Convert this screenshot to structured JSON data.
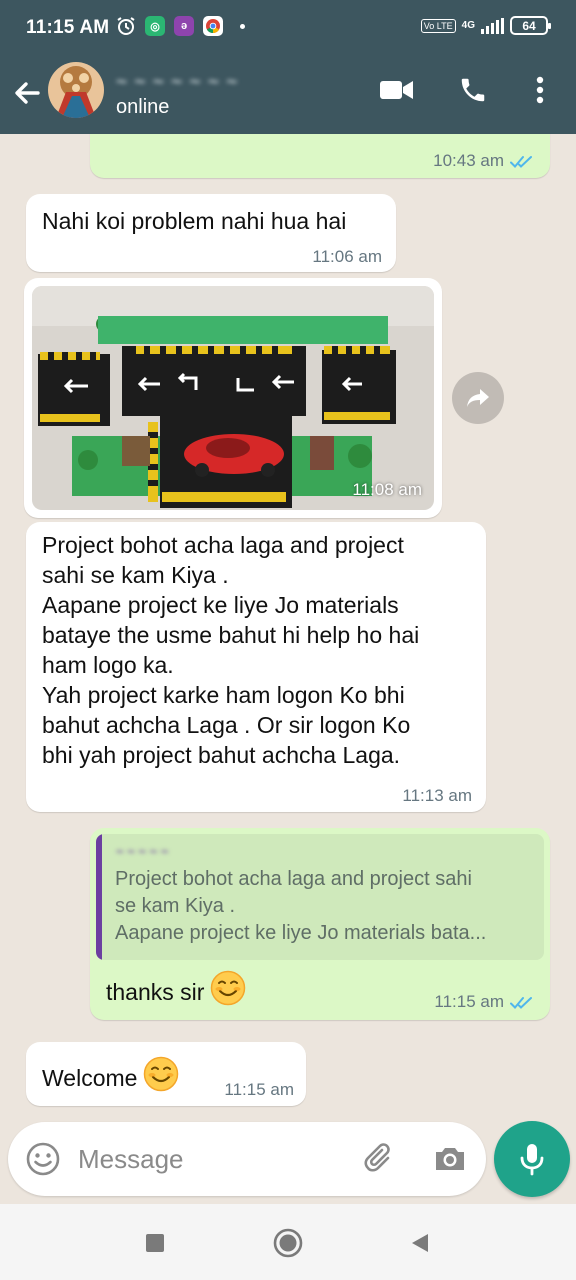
{
  "status_bar": {
    "time": "11:15 AM",
    "battery": "64",
    "network": "4G",
    "volte": "Vo LTE"
  },
  "header": {
    "contact_name": "~ ~ ~ ~ ~ ~ ~",
    "presence": "online"
  },
  "messages": [
    {
      "direction": "out",
      "partial": true,
      "time": "10:43 am",
      "status": "read"
    },
    {
      "direction": "in",
      "text": "Nahi koi problem nahi hua hai",
      "time": "11:06 am"
    },
    {
      "direction": "in",
      "type": "image",
      "time": "11:08 am"
    },
    {
      "direction": "in",
      "lines": [
        "Project bohot acha laga and project",
        "sahi se kam Kiya .",
        "Aapane project ke liye Jo materials",
        "bataye the usme bahut hi help ho hai",
        "ham logo ka.",
        "Yah project karke ham logon Ko bhi",
        "bahut achcha Laga . Or sir logon Ko",
        "bhi yah project bahut achcha Laga."
      ],
      "time": "11:13 am"
    },
    {
      "direction": "out",
      "quote": {
        "author": "~ ~ ~ ~ ~",
        "lines": [
          "Project bohot acha laga and project sahi",
          "se kam Kiya .",
          "Aapane project ke liye Jo materials bata..."
        ]
      },
      "text": "thanks sir",
      "emoji": "smiling-face",
      "time": "11:15 am",
      "status": "read"
    },
    {
      "direction": "in",
      "text": "Welcome",
      "emoji": "smiling-face",
      "time": "11:15 am"
    }
  ],
  "composer": {
    "placeholder": "Message"
  },
  "colors": {
    "header_bg": "#3d565f",
    "chat_bg": "#ece5dd",
    "outgoing_bubble": "#dcf8c6",
    "incoming_bubble": "#ffffff",
    "read_tick": "#4fb6ec",
    "mic_button": "#1fa38a",
    "quote_bar": "#6b3fa0"
  },
  "icons": [
    "back-arrow-icon",
    "video-call-icon",
    "phone-icon",
    "more-vert-icon",
    "forward-icon",
    "emoji-icon",
    "attach-icon",
    "camera-icon",
    "mic-icon",
    "nav-recents-icon",
    "nav-home-icon",
    "nav-back-icon"
  ]
}
